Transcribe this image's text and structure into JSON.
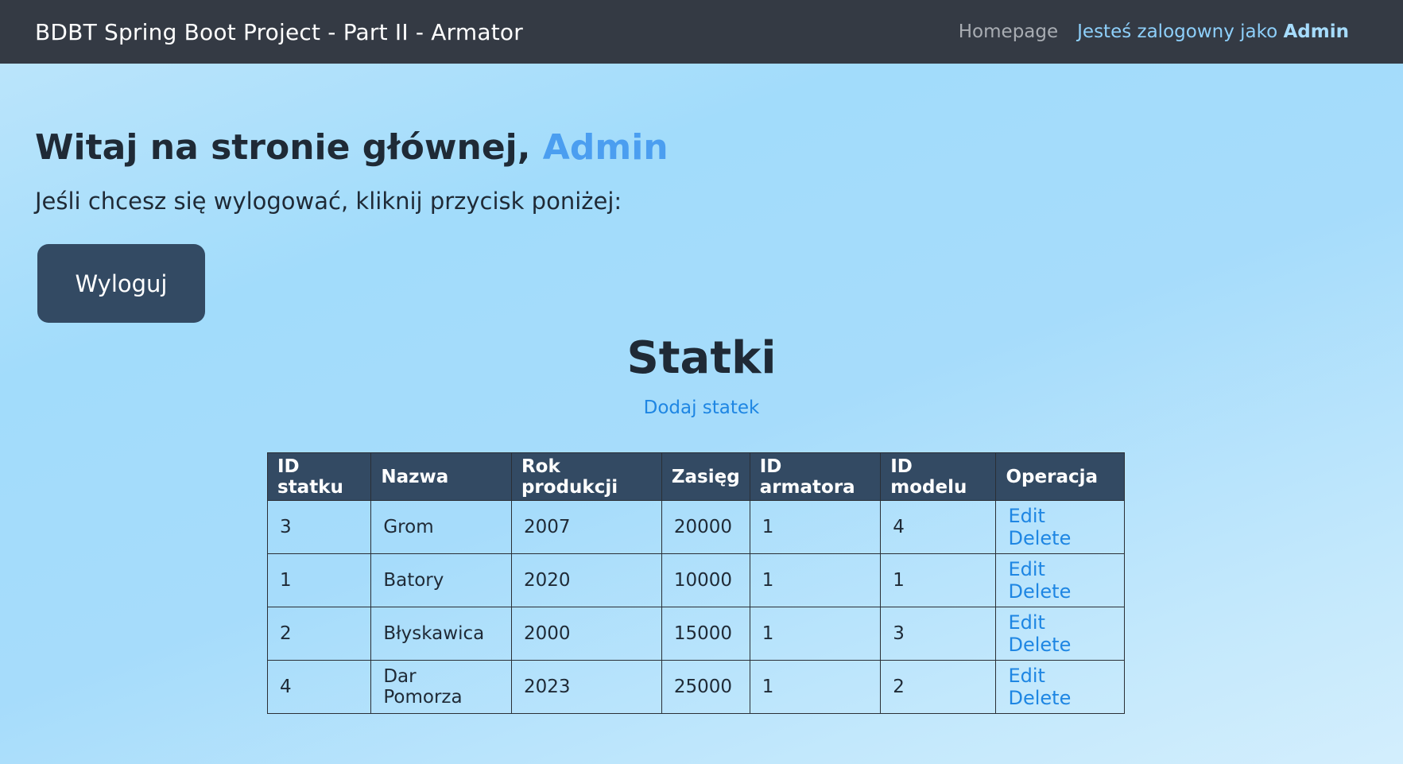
{
  "navbar": {
    "brand": "BDBT Spring Boot Project - Part II - Armator",
    "homepage_link": "Homepage",
    "logged_in_prefix": "Jesteś zalogowny jako",
    "logged_in_user": "Admin"
  },
  "welcome": {
    "text": "Witaj na stronie głównej,",
    "user": "Admin"
  },
  "logout": {
    "prompt": "Jeśli chcesz się wylogować, kliknij przycisk poniżej:",
    "button_label": "Wyloguj"
  },
  "ships": {
    "title": "Statki",
    "add_link": "Dodaj statek",
    "columns": [
      "ID statku",
      "Nazwa",
      "Rok produkcji",
      "Zasięg",
      "ID armatora",
      "ID modelu",
      "Operacja"
    ],
    "rows": [
      {
        "id": "3",
        "name": "Grom",
        "year": "2007",
        "range": "20000",
        "owner_id": "1",
        "model_id": "4",
        "edit": "Edit",
        "delete": "Delete"
      },
      {
        "id": "1",
        "name": "Batory",
        "year": "2020",
        "range": "10000",
        "owner_id": "1",
        "model_id": "1",
        "edit": "Edit",
        "delete": "Delete"
      },
      {
        "id": "2",
        "name": "Błyskawica",
        "year": "2000",
        "range": "15000",
        "owner_id": "1",
        "model_id": "3",
        "edit": "Edit",
        "delete": "Delete"
      },
      {
        "id": "4",
        "name": "Dar Pomorza",
        "year": "2023",
        "range": "25000",
        "owner_id": "1",
        "model_id": "2",
        "edit": "Edit",
        "delete": "Delete"
      }
    ]
  }
}
